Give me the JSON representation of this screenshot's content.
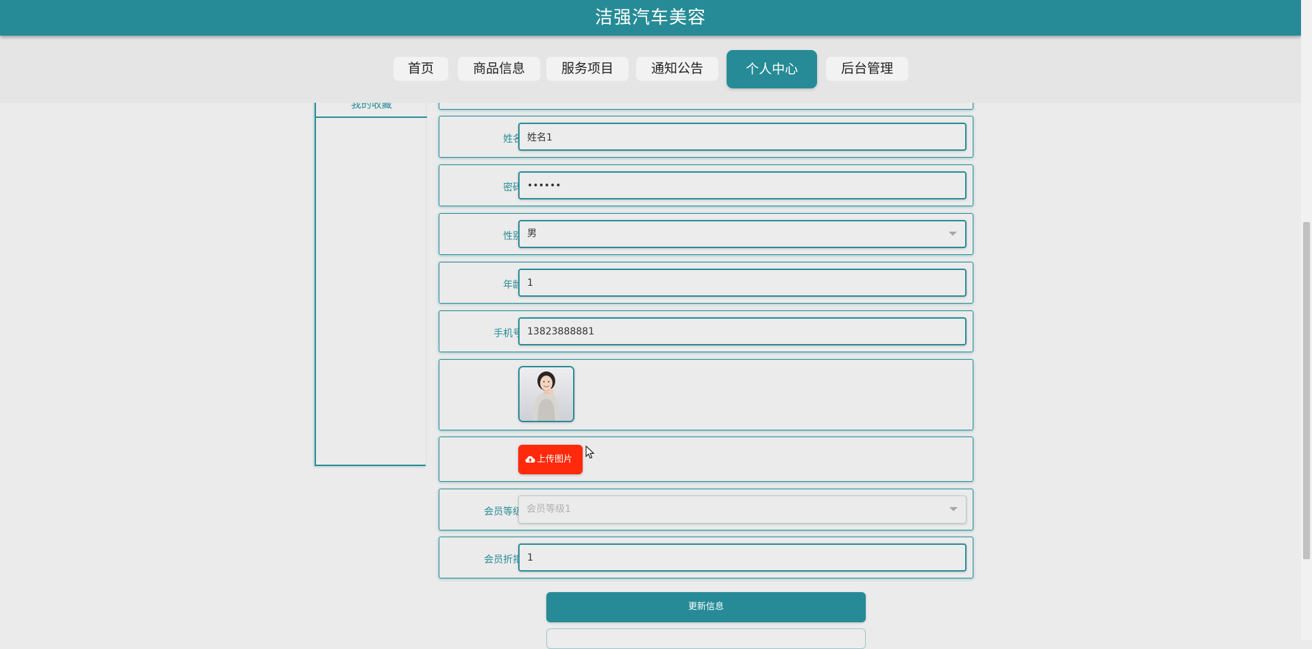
{
  "header": {
    "title": "洁强汽车美容"
  },
  "nav": {
    "items": [
      {
        "label": "首页"
      },
      {
        "label": "商品信息"
      },
      {
        "label": "服务项目"
      },
      {
        "label": "通知公告"
      },
      {
        "label": "个人中心",
        "active": true
      },
      {
        "label": "后台管理"
      }
    ]
  },
  "sidebar": {
    "items": [
      {
        "label": "我的收藏"
      }
    ]
  },
  "form": {
    "name": {
      "label": "姓名",
      "value": "姓名1"
    },
    "password": {
      "label": "密码",
      "value": "••••••"
    },
    "gender": {
      "label": "性别",
      "value": "男"
    },
    "age": {
      "label": "年龄",
      "value": "1"
    },
    "phone": {
      "label": "手机号",
      "value": "13823888881"
    },
    "upload": {
      "label": "上传图片"
    },
    "member_level": {
      "label": "会员等级",
      "value": "会员等级1"
    },
    "member_discount": {
      "label": "会员折扣",
      "value": "1"
    }
  },
  "actions": {
    "update_label": "更新信息"
  },
  "colors": {
    "primary": "#268b96",
    "upload_button": "#ff2a0c",
    "background": "#ebebeb"
  }
}
